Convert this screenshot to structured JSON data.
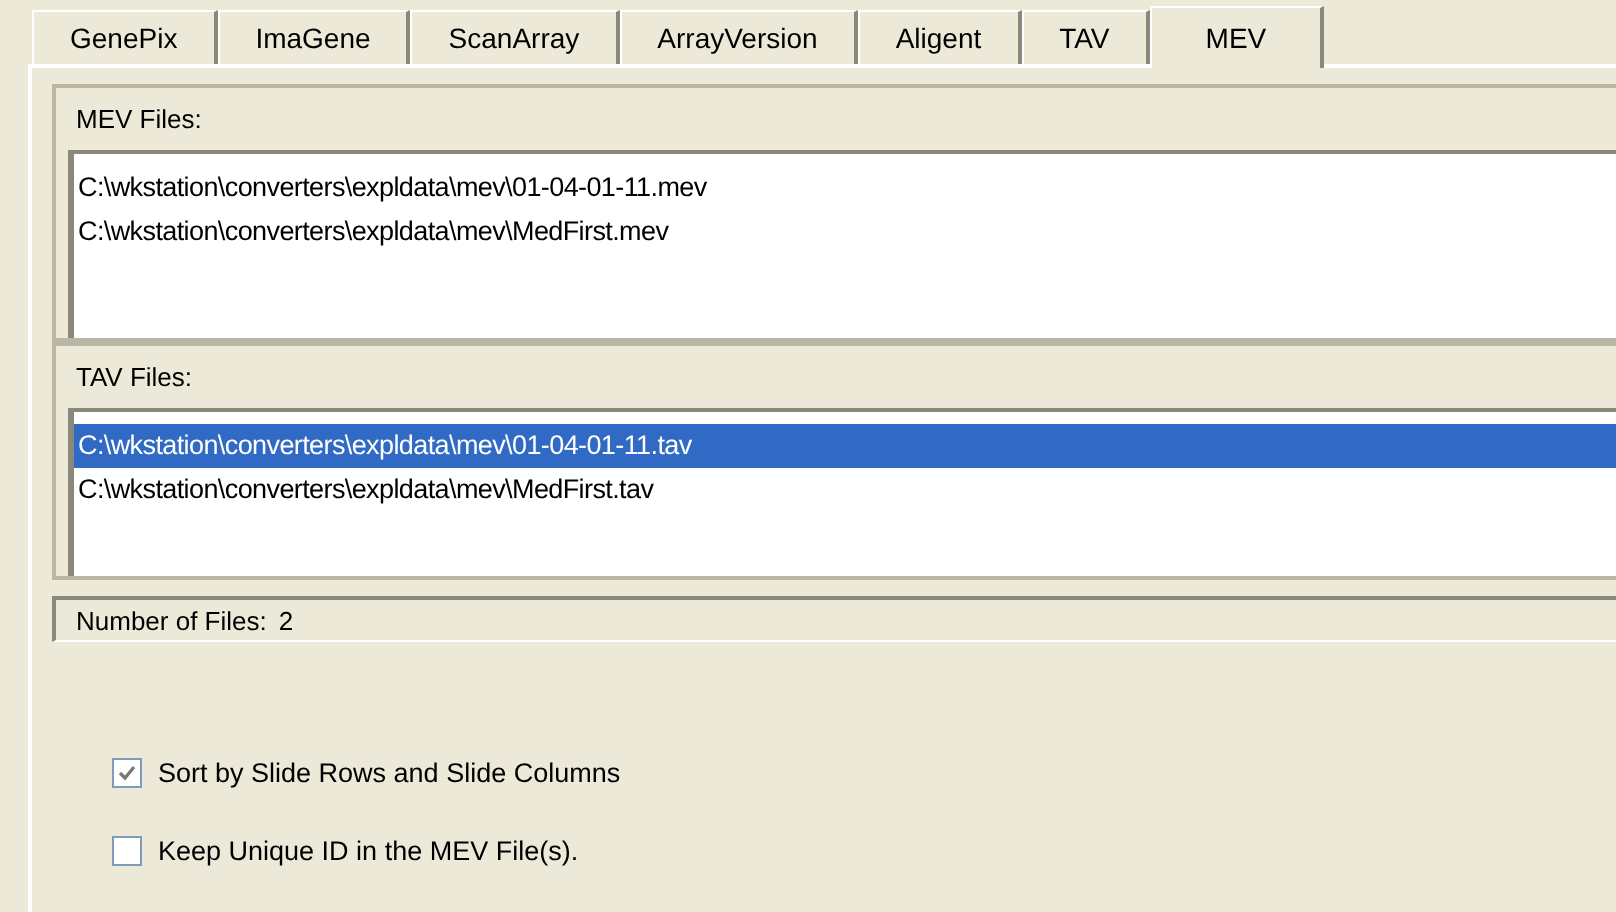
{
  "tabs": [
    {
      "label": "GenePix",
      "selected": false
    },
    {
      "label": "ImaGene",
      "selected": false
    },
    {
      "label": "ScanArray",
      "selected": false
    },
    {
      "label": "ArrayVersion",
      "selected": false
    },
    {
      "label": "Aligent",
      "selected": false
    },
    {
      "label": "TAV",
      "selected": false
    },
    {
      "label": "MEV",
      "selected": true
    }
  ],
  "mev_files": {
    "label": "MEV Files:",
    "items": [
      {
        "text": "C:\\wkstation\\converters\\expldata\\mev\\01-04-01-11.mev",
        "selected": false
      },
      {
        "text": "C:\\wkstation\\converters\\expldata\\mev\\MedFirst.mev",
        "selected": false
      }
    ]
  },
  "tav_files": {
    "label": "TAV Files:",
    "items": [
      {
        "text": "C:\\wkstation\\converters\\expldata\\mev\\01-04-01-11.tav",
        "selected": true
      },
      {
        "text": "C:\\wkstation\\converters\\expldata\\mev\\MedFirst.tav",
        "selected": false
      }
    ]
  },
  "status": {
    "label": "Number of Files:",
    "value": "2"
  },
  "options": [
    {
      "label": "Sort by Slide Rows and Slide Columns",
      "checked": true
    },
    {
      "label": "Keep Unique ID in the MEV File(s).",
      "checked": false
    }
  ]
}
